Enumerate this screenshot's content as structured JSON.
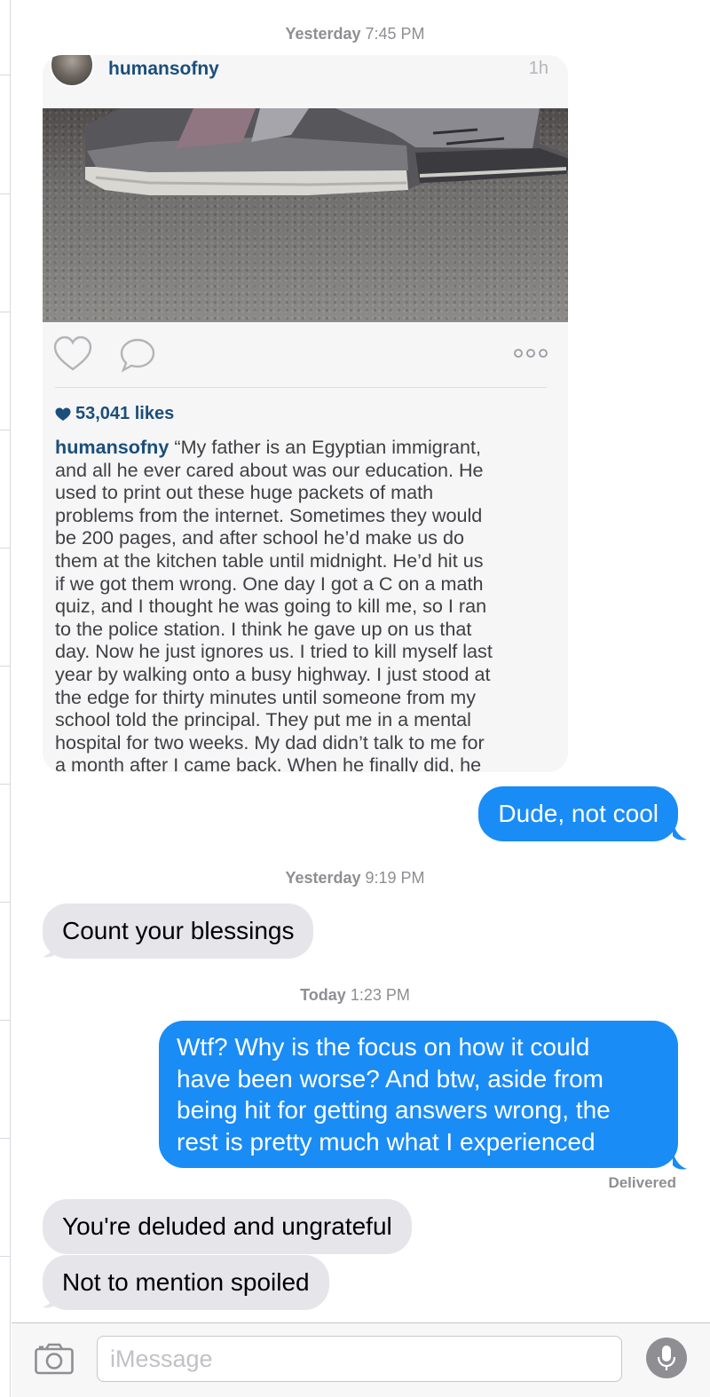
{
  "timestamps": [
    {
      "day": "Yesterday",
      "time": "7:45 PM"
    },
    {
      "day": "Yesterday",
      "time": "9:19 PM"
    },
    {
      "day": "Today",
      "time": "1:23 PM"
    }
  ],
  "shared_post": {
    "username": "humansofny",
    "time_ago": "1h",
    "likes": "53,041 likes",
    "caption_user": "humansofny",
    "caption_lines": [
      "“My father is an Egyptian immigrant,",
      "and all he ever cared about was our education.  He",
      "used to print out these huge packets of math",
      "problems from the internet.  Sometimes they would",
      "be 200 pages, and after school he’d make us do",
      "them at the kitchen table until midnight.  He’d hit us",
      "if we got them wrong.  One day I got a C on a math",
      "quiz, and I thought he was going to kill me, so I ran",
      "to the police station.  I think he gave up on us that",
      "day.  Now he just ignores us.  I tried to kill myself last",
      "year by walking onto a busy highway.  I just stood at",
      "the edge for thirty minutes until someone from my",
      "school told the principal.  They put me in a mental",
      "hospital for two weeks.  My dad didn’t talk to me for",
      "a month after I came back.  When he finally did, he"
    ]
  },
  "messages": [
    {
      "direction": "outgoing",
      "text": "Dude, not cool"
    },
    {
      "direction": "incoming",
      "text": "Count your blessings"
    },
    {
      "direction": "outgoing",
      "lines": [
        "Wtf? Why is the focus on how it could",
        "have been worse? And btw, aside from",
        "being hit for getting answers wrong, the",
        "rest is pretty much what I experienced"
      ]
    },
    {
      "direction": "incoming",
      "text": "You're deluded and ungrateful"
    },
    {
      "direction": "incoming",
      "text": "Not to mention spoiled"
    }
  ],
  "delivery_status": "Delivered",
  "input": {
    "placeholder": "iMessage",
    "value": ""
  },
  "icons": {
    "camera": "camera-icon",
    "mic": "microphone-icon",
    "heart": "heart-icon",
    "comment": "comment-icon",
    "more": "more-options-icon"
  },
  "colors": {
    "outgoing_bubble": "#1a8cf6",
    "incoming_bubble": "#e5e5ea",
    "instagram_link": "#1b4e7a",
    "timestamp": "#8e8e93"
  }
}
